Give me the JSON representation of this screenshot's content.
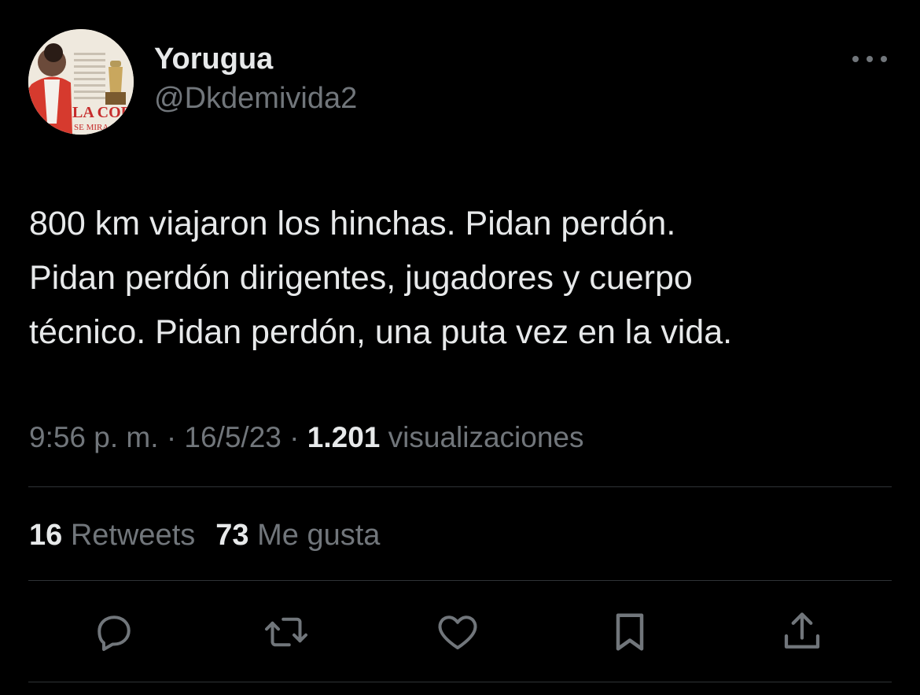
{
  "tweet": {
    "author": {
      "display_name": "Yorugua",
      "handle": "@Dkdemivida2",
      "avatar_caption": "LA COPA SE MIRA"
    },
    "text": "800 km viajaron los hinchas. Pidan perdón.\nPidan perdón dirigentes, jugadores y cuerpo\ntécnico. Pidan perdón, una puta vez en la vida.",
    "time": "9:56 p. m.",
    "date": "16/5/23",
    "separator": "·",
    "views_count": "1.201",
    "views_label": "visualizaciones",
    "retweets_count": "16",
    "retweets_label": "Retweets",
    "likes_count": "73",
    "likes_label": "Me gusta"
  },
  "icons": {
    "more": "more-horizontal-icon",
    "reply": "reply-icon",
    "retweet": "retweet-icon",
    "like": "heart-icon",
    "bookmark": "bookmark-icon",
    "share": "share-icon"
  },
  "colors": {
    "background": "#000000",
    "text_primary": "#e7e9ea",
    "text_secondary": "#71767b",
    "divider": "#2f3336"
  }
}
